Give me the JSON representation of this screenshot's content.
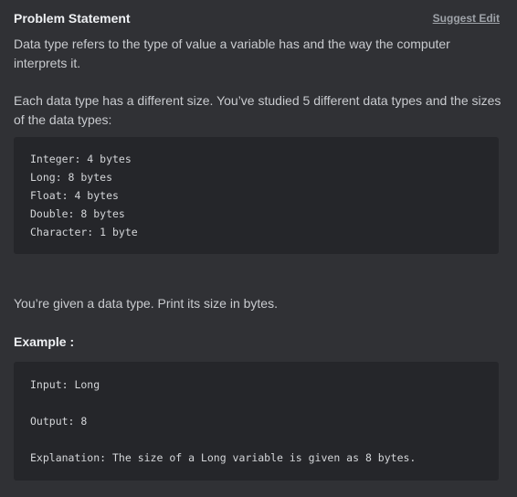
{
  "header": {
    "title": "Problem Statement",
    "suggest_edit": "Suggest Edit"
  },
  "paragraphs": [
    "Data type refers to the type of value a variable has and the way the computer interprets it.",
    "Each data type has a different size. You’ve studied 5 different data types and the sizes of the data types:",
    "You’re given a data type. Print its size in bytes."
  ],
  "sizes_code": [
    "Integer: 4 bytes",
    "Long: 8 bytes",
    "Float: 4 bytes",
    "Double: 8 bytes",
    "Character: 1 byte"
  ],
  "example": {
    "label": "Example :",
    "input": "Input: Long",
    "output": "Output: 8",
    "explanation": "Explanation: The size of a Long variable is given as 8 bytes."
  }
}
